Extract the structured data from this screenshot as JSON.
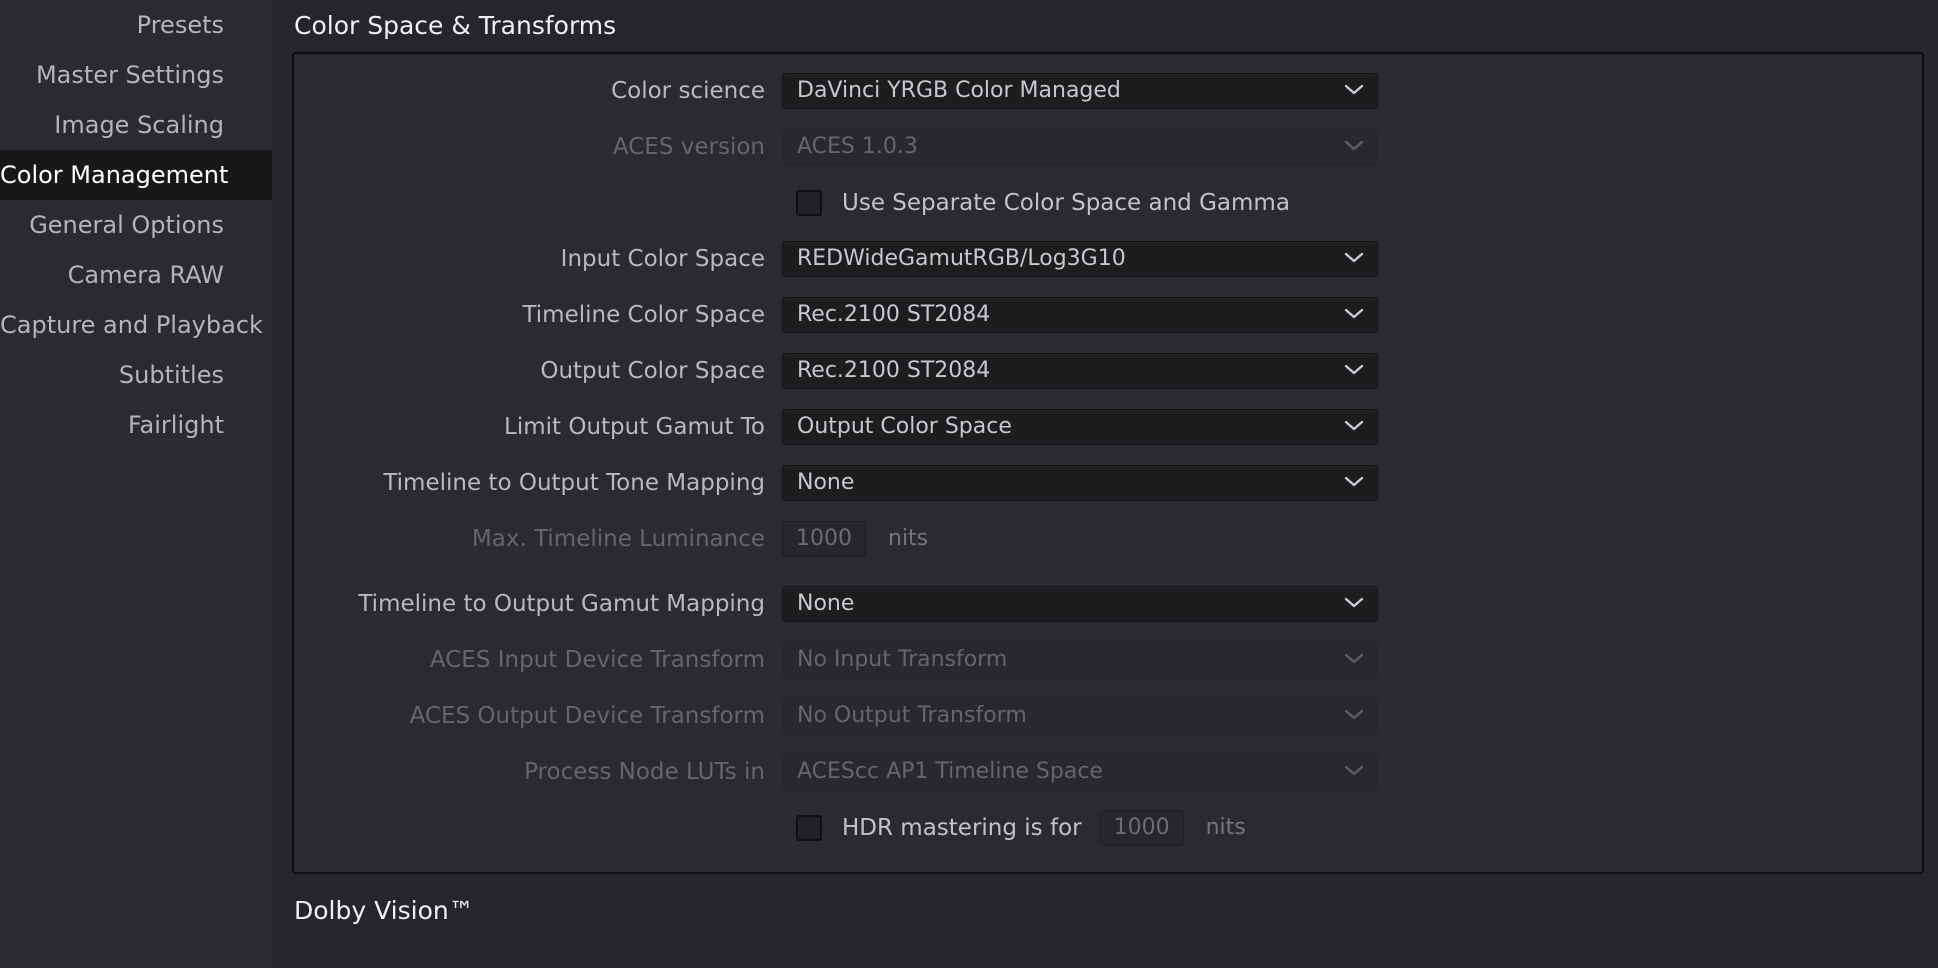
{
  "sidebar": {
    "items": [
      {
        "label": "Presets",
        "selected": false
      },
      {
        "label": "Master Settings",
        "selected": false
      },
      {
        "label": "Image Scaling",
        "selected": false
      },
      {
        "label": "Color Management",
        "selected": true
      },
      {
        "label": "General Options",
        "selected": false
      },
      {
        "label": "Camera RAW",
        "selected": false
      },
      {
        "label": "Capture and Playback",
        "selected": false
      },
      {
        "label": "Subtitles",
        "selected": false
      },
      {
        "label": "Fairlight",
        "selected": false
      }
    ]
  },
  "main": {
    "section_title": "Color Space & Transforms",
    "bottom_section_title": "Dolby Vision™",
    "rows": {
      "color_science": {
        "label": "Color science",
        "value": "DaVinci YRGB Color Managed",
        "disabled": false
      },
      "aces_version": {
        "label": "ACES version",
        "value": "ACES 1.0.3",
        "disabled": true
      },
      "use_separate": {
        "label": "Use Separate Color Space and Gamma",
        "checked": false
      },
      "input_color_space": {
        "label": "Input Color Space",
        "value": "REDWideGamutRGB/Log3G10",
        "disabled": false
      },
      "timeline_color_space": {
        "label": "Timeline Color Space",
        "value": "Rec.2100 ST2084",
        "disabled": false
      },
      "output_color_space": {
        "label": "Output Color Space",
        "value": "Rec.2100 ST2084",
        "disabled": false
      },
      "limit_output_gamut": {
        "label": "Limit Output Gamut To",
        "value": "Output Color Space",
        "disabled": false
      },
      "tone_mapping": {
        "label": "Timeline to Output Tone Mapping",
        "value": "None",
        "disabled": false
      },
      "max_luminance": {
        "label": "Max. Timeline Luminance",
        "value": "1000",
        "unit": "nits",
        "disabled": true
      },
      "gamut_mapping": {
        "label": "Timeline to Output Gamut Mapping",
        "value": "None",
        "disabled": false
      },
      "aces_idt": {
        "label": "ACES Input Device Transform",
        "value": "No Input Transform",
        "disabled": true
      },
      "aces_odt": {
        "label": "ACES Output Device Transform",
        "value": "No Output Transform",
        "disabled": true
      },
      "process_node_luts": {
        "label": "Process Node LUTs in",
        "value": "ACEScc AP1 Timeline Space",
        "disabled": true
      },
      "hdr_mastering": {
        "label": "HDR mastering is for",
        "value": "1000",
        "unit": "nits",
        "checked": false
      }
    }
  },
  "colors": {
    "background": "#25252b",
    "sidebar_background": "#2a2a30",
    "sidebar_selected": "#18181b",
    "panel_border": "#0e0e11",
    "text_primary": "#f0f0f2",
    "text_label": "#b8b8bd",
    "text_disabled": "#65656c",
    "dropdown_background": "#1d1d20"
  },
  "icons": {
    "chevron_down": "chevron-down-icon"
  }
}
